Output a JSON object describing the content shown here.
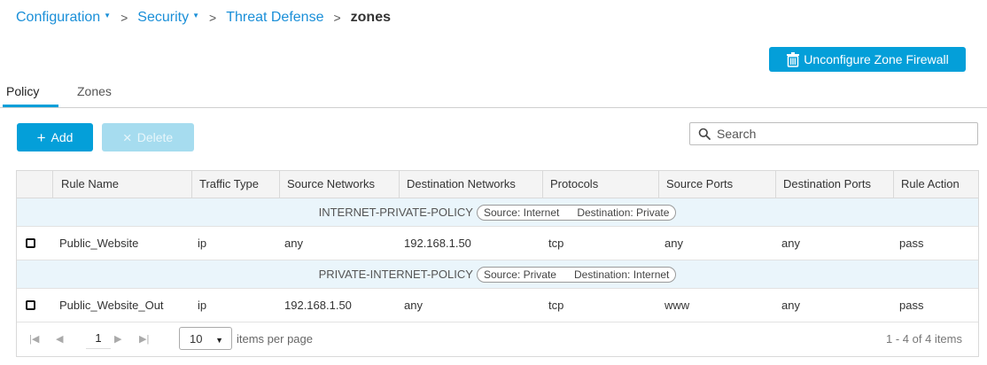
{
  "breadcrumb": {
    "items": [
      "Configuration",
      "Security",
      "Threat Defense"
    ],
    "current": "zones"
  },
  "actions": {
    "unconfigure_label": "Unconfigure Zone Firewall",
    "add_label": "Add",
    "delete_label": "Delete"
  },
  "tabs": [
    {
      "label": "Policy",
      "active": true
    },
    {
      "label": "Zones",
      "active": false
    }
  ],
  "search": {
    "placeholder": "Search"
  },
  "table": {
    "columns": [
      "Rule Name",
      "Traffic Type",
      "Source Networks",
      "Destination Networks",
      "Protocols",
      "Source Ports",
      "Destination Ports",
      "Rule Action"
    ],
    "groups": [
      {
        "name": "INTERNET-PRIVATE-POLICY",
        "source": "Source: Internet",
        "destination": "Destination: Private",
        "rows": [
          [
            "Public_Website",
            "ip",
            "any",
            "192.168.1.50",
            "tcp",
            "any",
            "any",
            "pass"
          ]
        ]
      },
      {
        "name": "PRIVATE-INTERNET-POLICY",
        "source": "Source: Private",
        "destination": "Destination: Internet",
        "rows": [
          [
            "Public_Website_Out",
            "ip",
            "192.168.1.50",
            "any",
            "tcp",
            "www",
            "any",
            "pass"
          ]
        ]
      }
    ]
  },
  "pager": {
    "page": "1",
    "page_size": "10",
    "page_size_label": "items per page",
    "info": "1 - 4 of 4 items"
  },
  "colors": {
    "accent": "#049fd9",
    "link": "#1a8fd8",
    "disabled_button": "#a6dcef",
    "group_row_bg": "#eaf5fb"
  }
}
